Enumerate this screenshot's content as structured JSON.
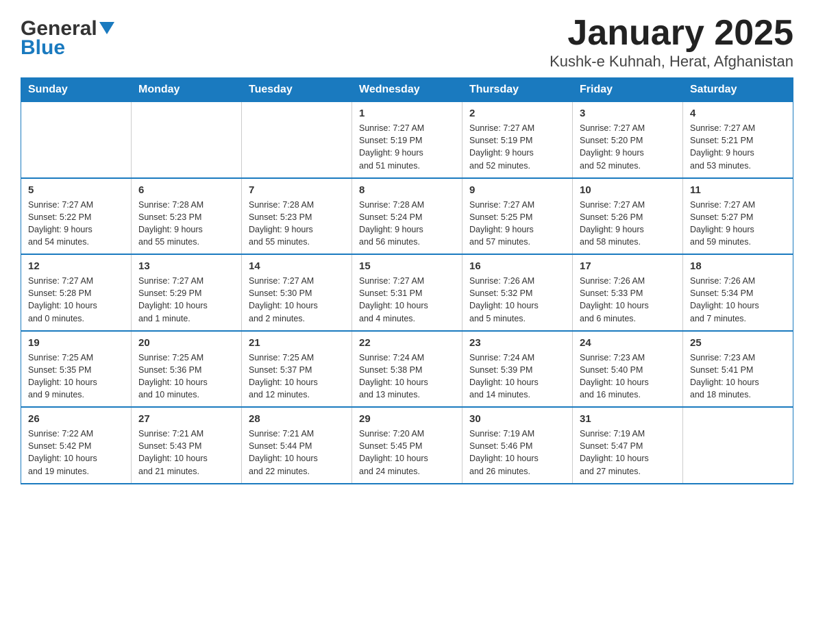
{
  "header": {
    "logo_general": "General",
    "logo_blue": "Blue",
    "title": "January 2025",
    "subtitle": "Kushk-e Kuhnah, Herat, Afghanistan"
  },
  "days_of_week": [
    "Sunday",
    "Monday",
    "Tuesday",
    "Wednesday",
    "Thursday",
    "Friday",
    "Saturday"
  ],
  "weeks": [
    [
      {
        "day": "",
        "info": ""
      },
      {
        "day": "",
        "info": ""
      },
      {
        "day": "",
        "info": ""
      },
      {
        "day": "1",
        "info": "Sunrise: 7:27 AM\nSunset: 5:19 PM\nDaylight: 9 hours\nand 51 minutes."
      },
      {
        "day": "2",
        "info": "Sunrise: 7:27 AM\nSunset: 5:19 PM\nDaylight: 9 hours\nand 52 minutes."
      },
      {
        "day": "3",
        "info": "Sunrise: 7:27 AM\nSunset: 5:20 PM\nDaylight: 9 hours\nand 52 minutes."
      },
      {
        "day": "4",
        "info": "Sunrise: 7:27 AM\nSunset: 5:21 PM\nDaylight: 9 hours\nand 53 minutes."
      }
    ],
    [
      {
        "day": "5",
        "info": "Sunrise: 7:27 AM\nSunset: 5:22 PM\nDaylight: 9 hours\nand 54 minutes."
      },
      {
        "day": "6",
        "info": "Sunrise: 7:28 AM\nSunset: 5:23 PM\nDaylight: 9 hours\nand 55 minutes."
      },
      {
        "day": "7",
        "info": "Sunrise: 7:28 AM\nSunset: 5:23 PM\nDaylight: 9 hours\nand 55 minutes."
      },
      {
        "day": "8",
        "info": "Sunrise: 7:28 AM\nSunset: 5:24 PM\nDaylight: 9 hours\nand 56 minutes."
      },
      {
        "day": "9",
        "info": "Sunrise: 7:27 AM\nSunset: 5:25 PM\nDaylight: 9 hours\nand 57 minutes."
      },
      {
        "day": "10",
        "info": "Sunrise: 7:27 AM\nSunset: 5:26 PM\nDaylight: 9 hours\nand 58 minutes."
      },
      {
        "day": "11",
        "info": "Sunrise: 7:27 AM\nSunset: 5:27 PM\nDaylight: 9 hours\nand 59 minutes."
      }
    ],
    [
      {
        "day": "12",
        "info": "Sunrise: 7:27 AM\nSunset: 5:28 PM\nDaylight: 10 hours\nand 0 minutes."
      },
      {
        "day": "13",
        "info": "Sunrise: 7:27 AM\nSunset: 5:29 PM\nDaylight: 10 hours\nand 1 minute."
      },
      {
        "day": "14",
        "info": "Sunrise: 7:27 AM\nSunset: 5:30 PM\nDaylight: 10 hours\nand 2 minutes."
      },
      {
        "day": "15",
        "info": "Sunrise: 7:27 AM\nSunset: 5:31 PM\nDaylight: 10 hours\nand 4 minutes."
      },
      {
        "day": "16",
        "info": "Sunrise: 7:26 AM\nSunset: 5:32 PM\nDaylight: 10 hours\nand 5 minutes."
      },
      {
        "day": "17",
        "info": "Sunrise: 7:26 AM\nSunset: 5:33 PM\nDaylight: 10 hours\nand 6 minutes."
      },
      {
        "day": "18",
        "info": "Sunrise: 7:26 AM\nSunset: 5:34 PM\nDaylight: 10 hours\nand 7 minutes."
      }
    ],
    [
      {
        "day": "19",
        "info": "Sunrise: 7:25 AM\nSunset: 5:35 PM\nDaylight: 10 hours\nand 9 minutes."
      },
      {
        "day": "20",
        "info": "Sunrise: 7:25 AM\nSunset: 5:36 PM\nDaylight: 10 hours\nand 10 minutes."
      },
      {
        "day": "21",
        "info": "Sunrise: 7:25 AM\nSunset: 5:37 PM\nDaylight: 10 hours\nand 12 minutes."
      },
      {
        "day": "22",
        "info": "Sunrise: 7:24 AM\nSunset: 5:38 PM\nDaylight: 10 hours\nand 13 minutes."
      },
      {
        "day": "23",
        "info": "Sunrise: 7:24 AM\nSunset: 5:39 PM\nDaylight: 10 hours\nand 14 minutes."
      },
      {
        "day": "24",
        "info": "Sunrise: 7:23 AM\nSunset: 5:40 PM\nDaylight: 10 hours\nand 16 minutes."
      },
      {
        "day": "25",
        "info": "Sunrise: 7:23 AM\nSunset: 5:41 PM\nDaylight: 10 hours\nand 18 minutes."
      }
    ],
    [
      {
        "day": "26",
        "info": "Sunrise: 7:22 AM\nSunset: 5:42 PM\nDaylight: 10 hours\nand 19 minutes."
      },
      {
        "day": "27",
        "info": "Sunrise: 7:21 AM\nSunset: 5:43 PM\nDaylight: 10 hours\nand 21 minutes."
      },
      {
        "day": "28",
        "info": "Sunrise: 7:21 AM\nSunset: 5:44 PM\nDaylight: 10 hours\nand 22 minutes."
      },
      {
        "day": "29",
        "info": "Sunrise: 7:20 AM\nSunset: 5:45 PM\nDaylight: 10 hours\nand 24 minutes."
      },
      {
        "day": "30",
        "info": "Sunrise: 7:19 AM\nSunset: 5:46 PM\nDaylight: 10 hours\nand 26 minutes."
      },
      {
        "day": "31",
        "info": "Sunrise: 7:19 AM\nSunset: 5:47 PM\nDaylight: 10 hours\nand 27 minutes."
      },
      {
        "day": "",
        "info": ""
      }
    ]
  ]
}
